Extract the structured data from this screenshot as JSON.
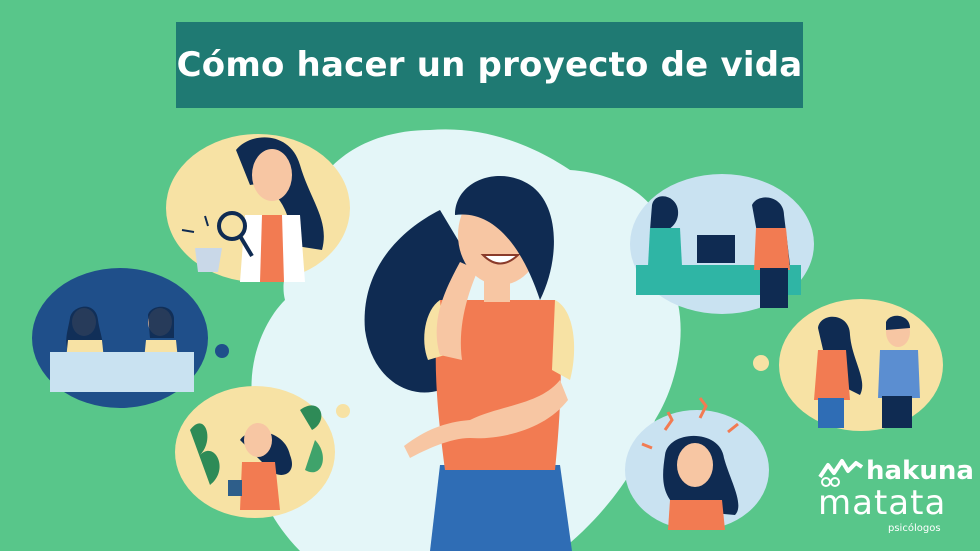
{
  "title": "Cómo hacer un proyecto de vida",
  "brand": {
    "name_line1": "hakuna",
    "name_line2": "matata",
    "tagline": "psicólogos"
  },
  "colors": {
    "background": "#58c68a",
    "banner": "#1f7a73",
    "cloud": "#e4f6f8",
    "hair": "#0f2b52",
    "skin": "#f7c6a3",
    "shirt": "#f27b52"
  },
  "illustrations": [
    "scientist-with-magnifier",
    "two-women-holding-sign",
    "woman-with-plants",
    "receptionist-at-desk",
    "couple-walking",
    "stressed-woman",
    "thinking-woman"
  ]
}
